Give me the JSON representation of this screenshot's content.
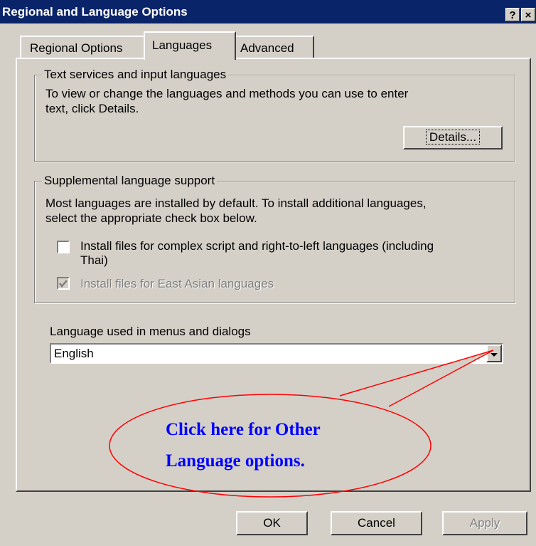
{
  "window": {
    "title": "Regional and Language Options",
    "help": "?",
    "close": "×"
  },
  "tabs": [
    {
      "label": "Regional Options"
    },
    {
      "label": "Languages"
    },
    {
      "label": "Advanced"
    }
  ],
  "text_services": {
    "legend": "Text services and input languages",
    "desc_line1": "To view or change the languages and methods you can use to enter",
    "desc_line2": "text, click Details.",
    "details_button": "Details..."
  },
  "supplemental": {
    "legend": "Supplemental language support",
    "desc_line1": "Most languages are installed by default. To install additional languages,",
    "desc_line2": "select the appropriate check box below.",
    "complex_script_line1": "Install files for complex script and right-to-left languages (including",
    "complex_script_line2": "Thai)",
    "east_asian": "Install files for East Asian languages",
    "complex_script_checked": false,
    "east_asian_checked": true
  },
  "menu_language": {
    "label": "Language used in menus and dialogs",
    "selected": "English"
  },
  "callout": {
    "line1": "Click here for Other",
    "line2": "Language options.",
    "color": "#0000ff",
    "outline_color": "#ff0000"
  },
  "buttons": {
    "ok": "OK",
    "cancel": "Cancel",
    "apply": "Apply"
  }
}
